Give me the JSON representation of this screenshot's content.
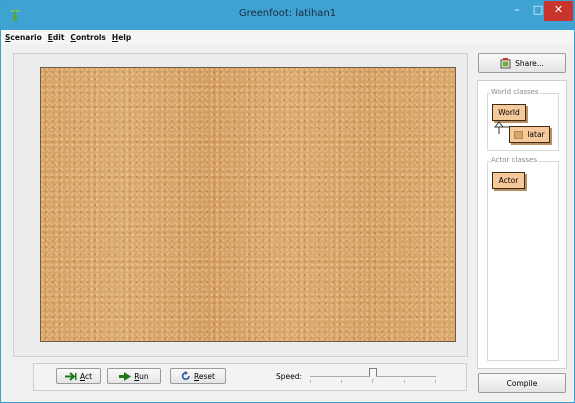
{
  "window": {
    "title": "Greenfoot: latihan1",
    "minimize_glyph": "–",
    "maximize_glyph": "□",
    "close_glyph": "✕",
    "accent_color": "#3ea3d3",
    "close_color": "#c7352e"
  },
  "menu": {
    "items": [
      {
        "first": "S",
        "rest": "cenario"
      },
      {
        "first": "E",
        "rest": "dit"
      },
      {
        "first": "C",
        "rest": "ontrols"
      },
      {
        "first": "H",
        "rest": "elp"
      }
    ]
  },
  "controls": {
    "act": {
      "first": "A",
      "rest": "ct"
    },
    "run": {
      "first": "R",
      "rest": "un"
    },
    "reset": {
      "first": "R",
      "rest": "eset"
    },
    "speed_label": "Speed:",
    "speed_fraction": 0.5
  },
  "right_panel": {
    "share_label": "Share...",
    "world_classes_title": "World classes",
    "actor_classes_title": "Actor classes",
    "world_class": "World",
    "subclass": "latar",
    "actor_class": "Actor",
    "compile_label": "Compile"
  },
  "icons": {
    "app": "greenfoot-icon",
    "act": "step-arrow-icon",
    "run": "play-icon",
    "reset": "reset-icon",
    "share": "share-icon"
  }
}
